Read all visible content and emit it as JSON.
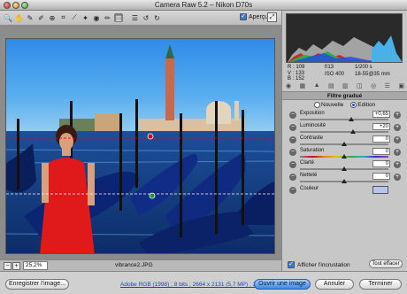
{
  "window": {
    "title": "Camera Raw 5.2  –  Nikon D70s"
  },
  "toolbar": {
    "tools": [
      {
        "name": "zoom-tool-icon",
        "glyph": "🔍"
      },
      {
        "name": "hand-tool-icon",
        "glyph": "✋"
      },
      {
        "name": "white-balance-icon",
        "glyph": "✎"
      },
      {
        "name": "color-sampler-icon",
        "glyph": "✐"
      },
      {
        "name": "targeted-adjustment-icon",
        "glyph": "⊕"
      },
      {
        "name": "crop-icon",
        "glyph": "⌗"
      },
      {
        "name": "straighten-icon",
        "glyph": "⟋"
      },
      {
        "name": "spot-removal-icon",
        "glyph": "✦"
      },
      {
        "name": "red-eye-icon",
        "glyph": "◉"
      },
      {
        "name": "adjustment-brush-icon",
        "glyph": "✏"
      },
      {
        "name": "graduated-filter-icon",
        "glyph": "▥"
      },
      {
        "name": "preferences-icon",
        "glyph": "☰"
      },
      {
        "name": "rotate-left-icon",
        "glyph": "↺"
      },
      {
        "name": "rotate-right-icon",
        "glyph": "↻"
      }
    ],
    "active_tool": "graduated-filter-icon",
    "preview_label": "Aperçu",
    "preview_checked": true
  },
  "readout": {
    "r": "R : 109",
    "g": "V : 133",
    "b": "B : 152",
    "aperture": "f/13",
    "shutter": "1/200 s",
    "iso": "ISO 400",
    "focal": "18-55@35 mm"
  },
  "panel": {
    "section_title": "Filtre gradué",
    "mode_new": "Nouvelle",
    "mode_edit": "Edition",
    "mode_selected": "Edition",
    "adjustments": [
      {
        "id": "exposure",
        "label": "Exposition",
        "value": "+0,65",
        "level": 0.58
      },
      {
        "id": "brightness",
        "label": "Luminosité",
        "value": "+20",
        "level": 0.6
      },
      {
        "id": "contrast",
        "label": "Contraste",
        "value": "0",
        "level": 0.5
      },
      {
        "id": "saturation",
        "label": "Saturation",
        "value": "0",
        "level": 0.5
      },
      {
        "id": "clarity",
        "label": "Clarté",
        "value": "0",
        "level": 0.5
      },
      {
        "id": "sharpness",
        "label": "Netteté",
        "value": "0",
        "level": 0.5
      }
    ],
    "color_label": "Couleur",
    "color_swatch": "#b9c3f0",
    "overlay_label": "Afficher l'incrustation",
    "overlay_checked": true,
    "clear_all": "Tout effacer"
  },
  "status": {
    "zoom": "25,2%",
    "filename": "vibrance2.JPG"
  },
  "bottom": {
    "save": "Enregistrer l'image...",
    "workflow_link": "Adobe RGB (1998) ; 8 bits ; 2664 x 2131 (5,7 MP) ; 240 ppi",
    "open": "Ouvrir une image",
    "cancel": "Annuler",
    "done": "Terminer"
  }
}
